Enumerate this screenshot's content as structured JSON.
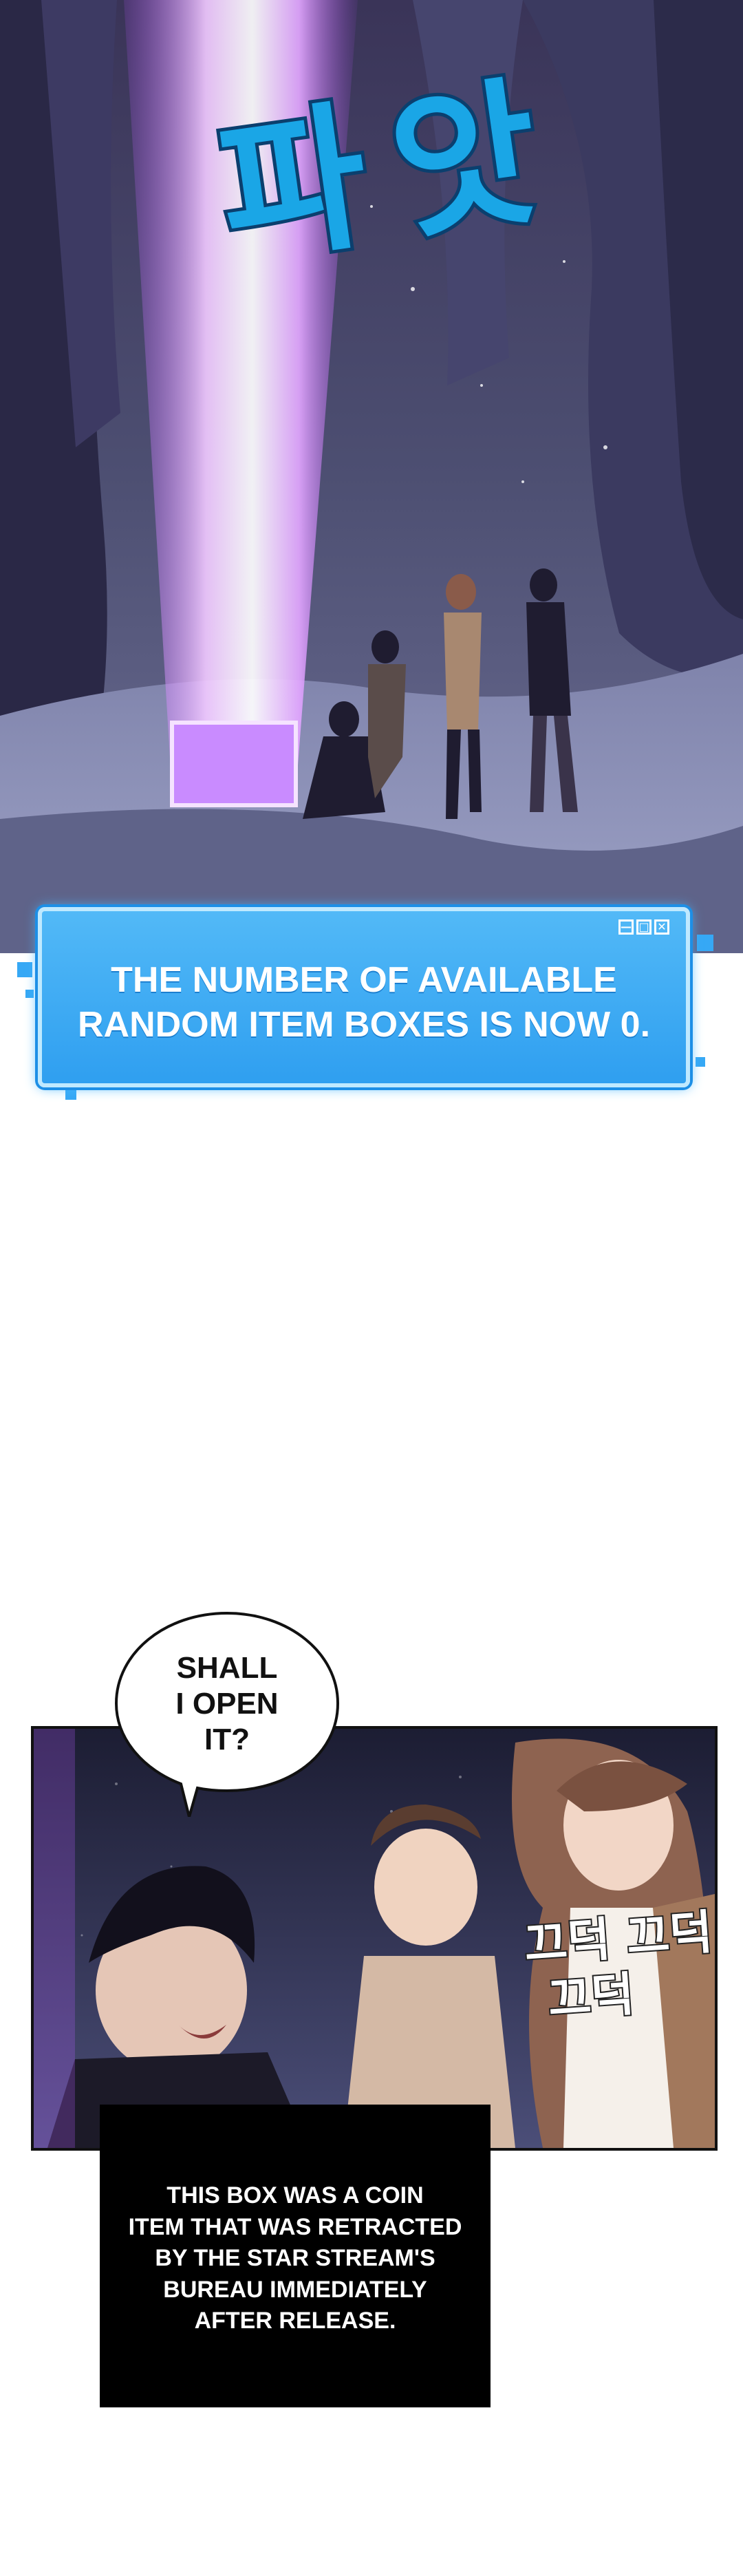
{
  "panels": {
    "panel1": {
      "sfx": "파앗"
    },
    "system_window": {
      "controls": [
        "—",
        "□",
        "✕"
      ],
      "message_line1": "THE NUMBER OF AVAILABLE",
      "message_line2": "RANDOM ITEM BOXES IS NOW 0."
    },
    "panel2": {
      "speech_bubble": {
        "line1": "SHALL",
        "line2": "I OPEN",
        "line3": "IT?"
      },
      "sfx_line1": "끄덕 끄덕",
      "sfx_line2": "끄덕"
    },
    "narration": {
      "line1": "THIS BOX WAS A COIN",
      "line2": "ITEM THAT WAS RETRACTED",
      "line3": "BY THE STAR STREAM'S",
      "line4": "BUREAU IMMEDIATELY",
      "line5": "AFTER RELEASE."
    }
  },
  "colors": {
    "beam": "#e6a8ff",
    "system_blue": "#3aa7f4",
    "sfx_cyan": "#19a7e8",
    "night_bg": "#2a2d4a"
  }
}
